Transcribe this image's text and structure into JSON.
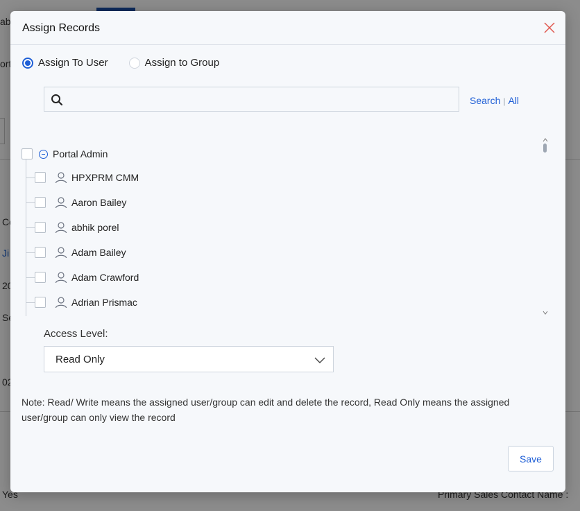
{
  "background": {
    "fragments": [
      "ab",
      "ortu",
      "Co",
      "Ji",
      "20",
      "Se",
      "02",
      "Yes",
      "Primary Sales Contact Name :"
    ]
  },
  "modal": {
    "title": "Assign Records",
    "close_icon": "close-icon",
    "assign_options": [
      {
        "label": "Assign To User",
        "selected": true
      },
      {
        "label": "Assign to Group",
        "selected": false
      }
    ],
    "search": {
      "placeholder": "",
      "value": "",
      "search_label": "Search",
      "separator": "|",
      "all_label": "All"
    },
    "tree": {
      "root": {
        "label": "Portal Admin",
        "expanded": true,
        "checked": false
      },
      "users": [
        {
          "name": "HPXPRM CMM",
          "checked": false
        },
        {
          "name": "Aaron Bailey",
          "checked": false
        },
        {
          "name": "abhik porel",
          "checked": false
        },
        {
          "name": "Adam Bailey",
          "checked": false
        },
        {
          "name": "Adam Crawford",
          "checked": false
        },
        {
          "name": "Adrian Prismac",
          "checked": false
        }
      ]
    },
    "access_level": {
      "label": "Access Level:",
      "selected": "Read Only"
    },
    "note": "Note: Read/ Write means the assigned user/group can edit and delete the record, Read Only means the assigned user/group can only view the record",
    "save_label": "Save"
  },
  "colors": {
    "accent": "#1f5fd6",
    "close": "#e0584f",
    "modal_bg": "#f6f8fb"
  }
}
